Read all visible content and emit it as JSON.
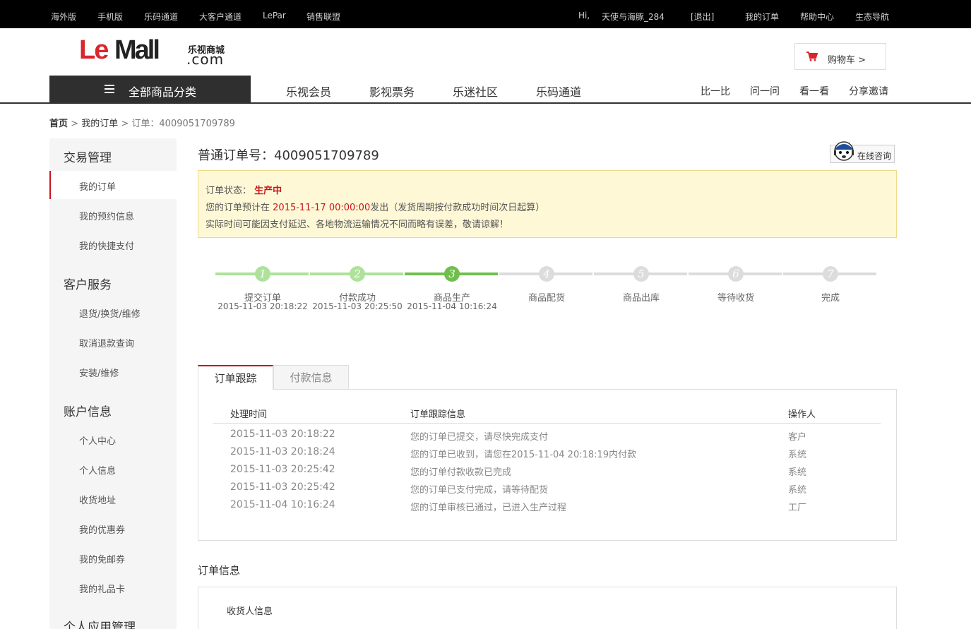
{
  "topbar": {
    "left_links": [
      "海外版",
      "手机版",
      "乐码通道",
      "大客户通道",
      "LePar",
      "销售联盟"
    ],
    "greeting": "Hi,",
    "username": "天使与海豚_284",
    "logout": "[退出]",
    "right_links": [
      "我的订单",
      "帮助中心",
      "生态导航"
    ]
  },
  "logo": {
    "le": "Le",
    "mall": "Mall",
    "cn": "乐视商城",
    "com": ".com"
  },
  "cart": {
    "label": "购物车 >"
  },
  "category": {
    "label": "全部商品分类"
  },
  "nav": {
    "items": [
      "乐视会员",
      "影视票务",
      "乐迷社区",
      "乐码通道"
    ]
  },
  "subnav": {
    "items": [
      "比一比",
      "问一问",
      "看一看",
      "分享邀请"
    ]
  },
  "breadcrumb": {
    "home": "首页",
    "sep1": ">",
    "orders": "我的订单",
    "sep2": ">",
    "current": "订单：4009051709789"
  },
  "sidebar": {
    "sections": [
      {
        "title": "交易管理",
        "items": [
          "我的订单",
          "我的预约信息",
          "我的快捷支付"
        ]
      },
      {
        "title": "客户服务",
        "items": [
          "退货/换货/维修",
          "取消退款查询",
          "安装/维修"
        ]
      },
      {
        "title": "账户信息",
        "items": [
          "个人中心",
          "个人信息",
          "收货地址",
          "我的优惠券",
          "我的免邮券",
          "我的礼品卡"
        ]
      },
      {
        "title": "个人应用管理",
        "items": []
      }
    ]
  },
  "order": {
    "title": "普通订单号：4009051709789",
    "consult": "在线咨询",
    "status_label": "订单状态：",
    "status_value": "生产中",
    "ship_prefix": "您的订单预计在",
    "ship_date": "2015-11-17 00:00:00",
    "ship_suffix": "发出（发货周期按付款成功时间次日起算）",
    "note": "实际时间可能因支付延迟、各地物流运输情况不同而略有误差，敬请谅解！"
  },
  "progress": {
    "current_step": 3,
    "steps": [
      {
        "num": "1",
        "name": "提交订单",
        "date": "2015-11-03 20:18:22"
      },
      {
        "num": "2",
        "name": "付款成功",
        "date": "2015-11-03 20:25:50"
      },
      {
        "num": "3",
        "name": "商品生产",
        "date": "2015-11-04 10:16:24"
      },
      {
        "num": "4",
        "name": "商品配货",
        "date": ""
      },
      {
        "num": "5",
        "name": "商品出库",
        "date": ""
      },
      {
        "num": "6",
        "name": "等待收货",
        "date": ""
      },
      {
        "num": "7",
        "name": "完成",
        "date": ""
      }
    ]
  },
  "tabs": {
    "active": "订单跟踪",
    "inactive": "付款信息"
  },
  "tracking": {
    "headers": [
      "处理时间",
      "订单跟踪信息",
      "操作人"
    ],
    "rows": [
      [
        "2015-11-03 20:18:22",
        "您的订单已提交，请尽快完成支付",
        "客户"
      ],
      [
        "2015-11-03 20:18:24",
        "您的订单已收到，请您在2015-11-04 20:18:19内付款",
        "系统"
      ],
      [
        "2015-11-03 20:25:42",
        "您的订单付款收款已完成",
        "系统"
      ],
      [
        "2015-11-03 20:25:42",
        "您的订单已支付完成，请等待配货",
        "系统"
      ],
      [
        "2015-11-04 10:16:24",
        "您的订单审核已通过，已进入生产过程",
        "工厂"
      ]
    ]
  },
  "order_info": {
    "title": "订单信息",
    "consignee_label": "收货人信息"
  },
  "colors": {
    "brand_red": "#c8161d",
    "step_done": "#aee29a",
    "step_current": "#6fbf4d",
    "step_todo": "#dcdcdc",
    "notice_bg": "#fff8d7"
  }
}
